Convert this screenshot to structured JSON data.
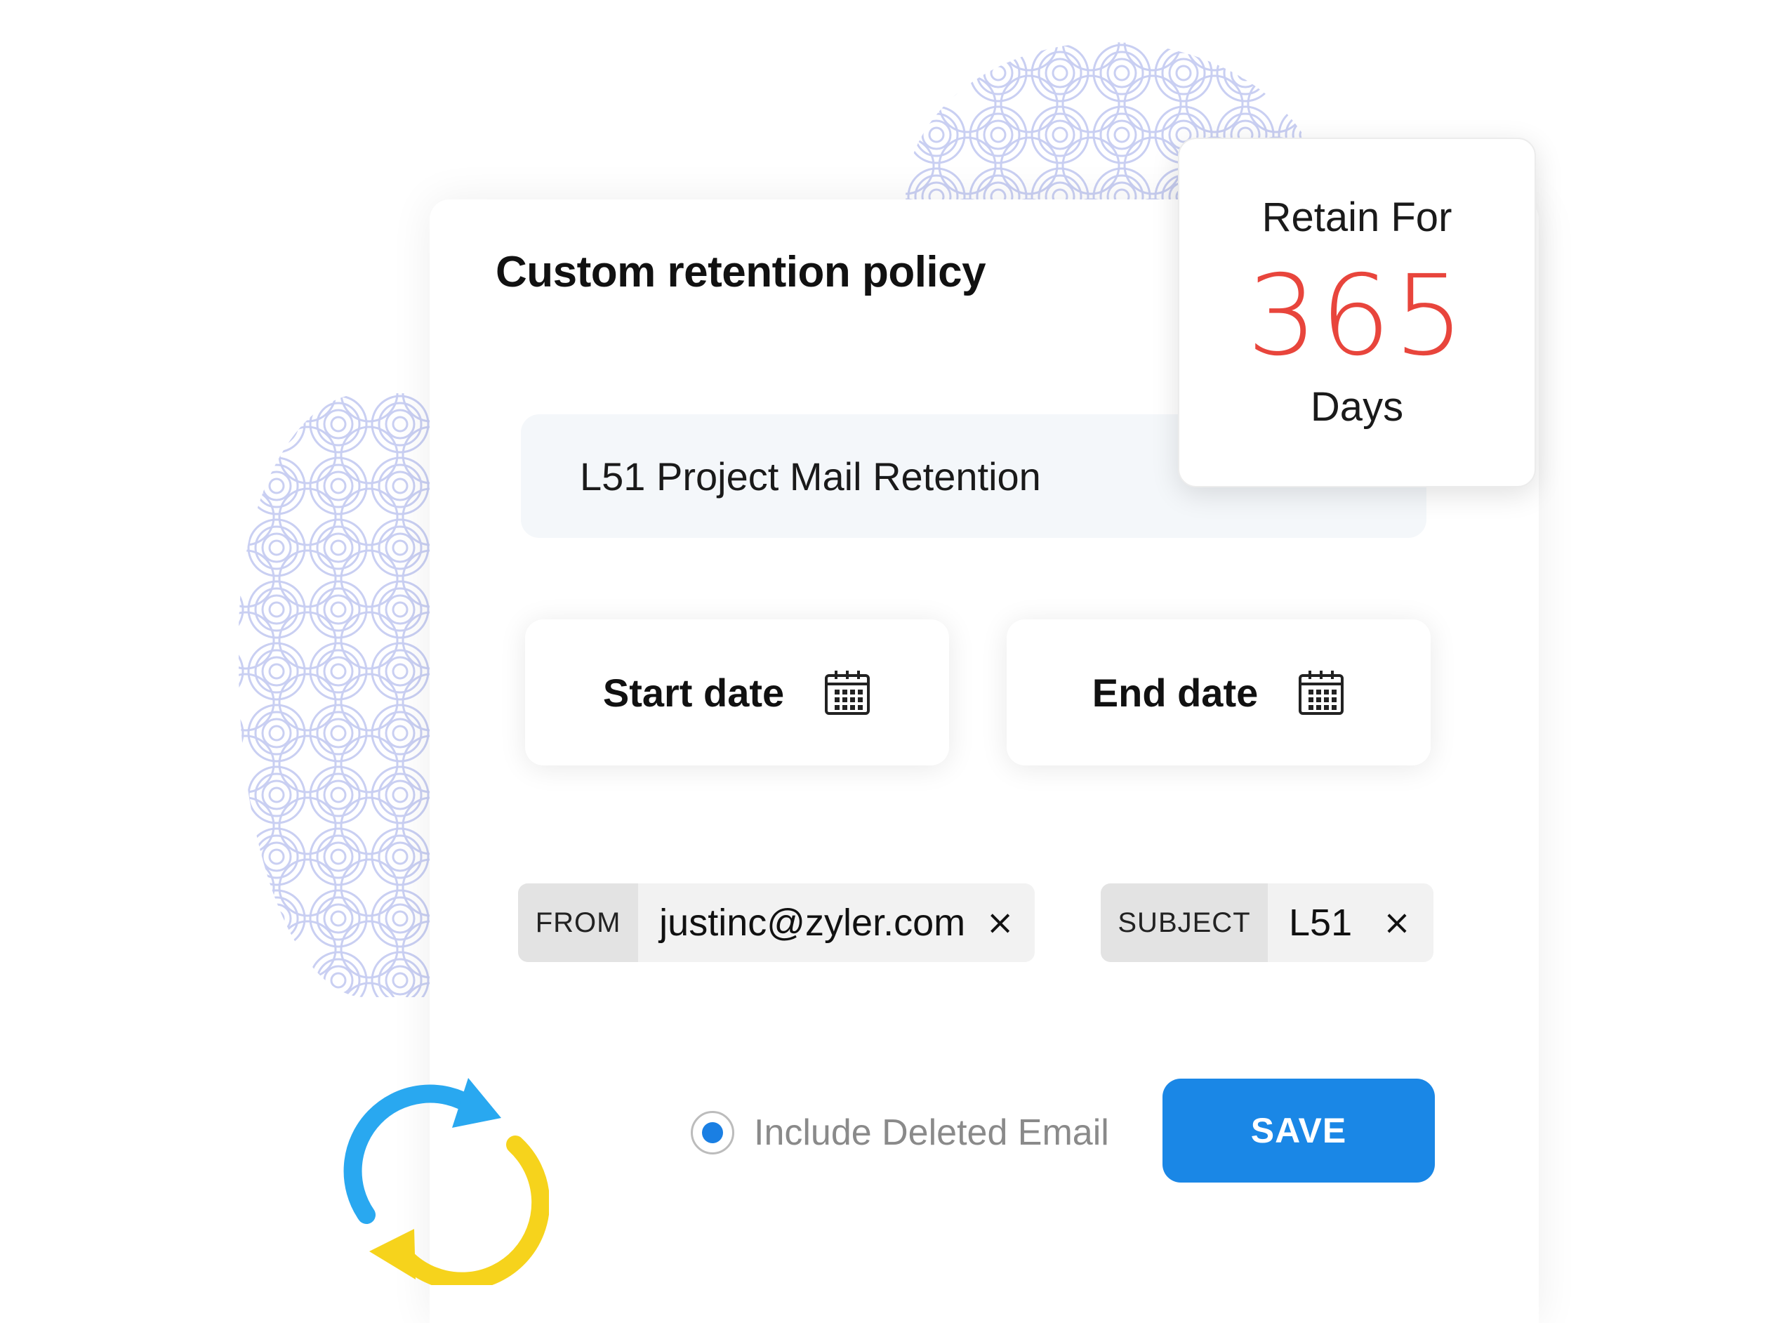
{
  "card": {
    "title": "Custom retention policy",
    "policy_name": "L51 Project Mail Retention"
  },
  "retention": {
    "label": "Retain For",
    "value": "365",
    "unit": "Days",
    "value_color": "#e8453c"
  },
  "dates": {
    "start_label": "Start date",
    "end_label": "End date",
    "icon": "calendar-icon"
  },
  "filters": [
    {
      "key": "FROM",
      "value": "justinc@zyler.com",
      "remove": "×"
    },
    {
      "key": "SUBJECT",
      "value": "L51",
      "remove": "×"
    }
  ],
  "options": {
    "include_deleted_label": "Include Deleted Email",
    "include_deleted_selected": true
  },
  "actions": {
    "save_label": "SAVE",
    "save_color": "#1a87e6"
  },
  "decor": {
    "sync_icon": "sync-icon",
    "sync_colors": [
      "#29a8f0",
      "#f6d31c"
    ],
    "pattern_color": "#c9cff2"
  }
}
